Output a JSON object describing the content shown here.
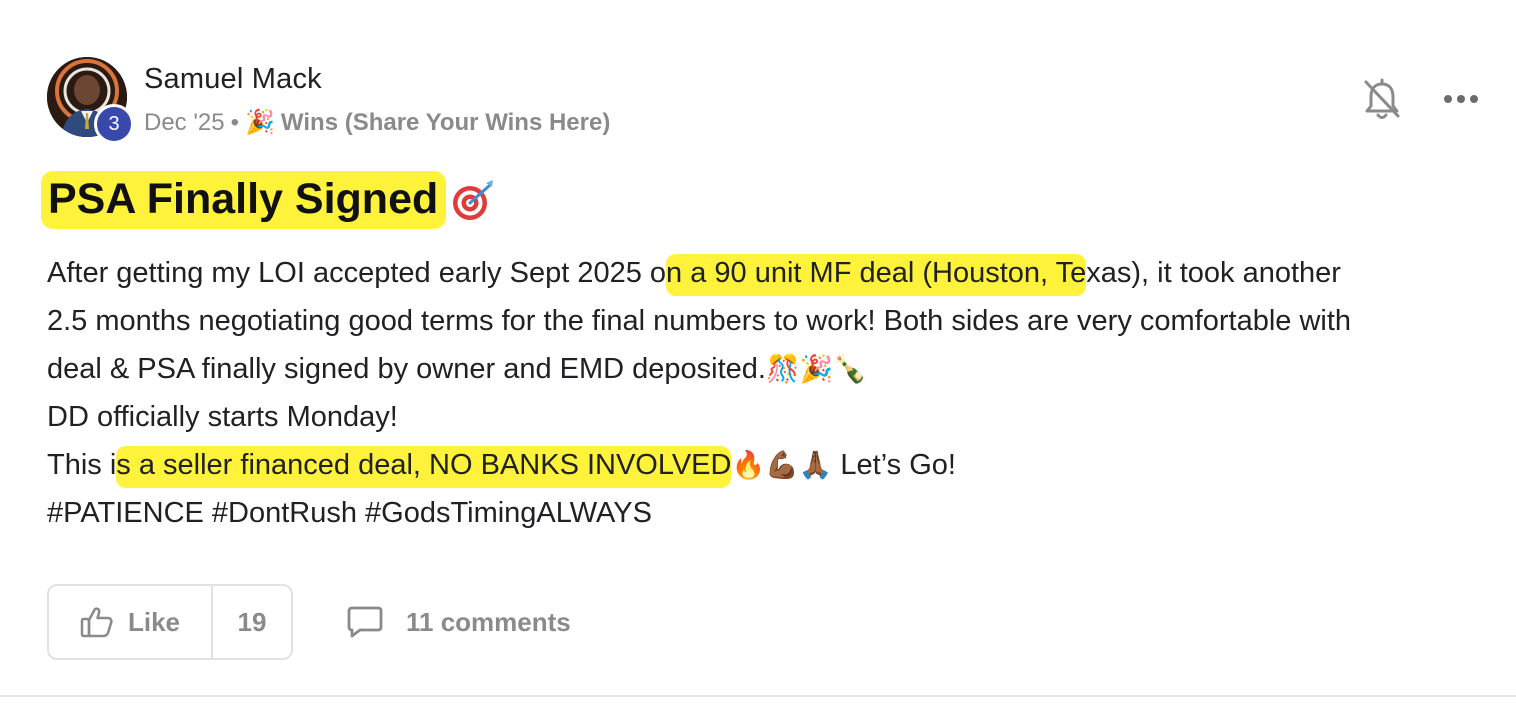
{
  "author": {
    "name": "Samuel Mack",
    "level": "3"
  },
  "meta": {
    "date": "Dec '25",
    "separator": "•",
    "category_icon": "party-popper-icon",
    "category": "Wins (Share Your Wins Here)"
  },
  "post": {
    "title": "PSA Finally Signed",
    "title_icon": "dart-target-icon",
    "body": {
      "l1_pre": "After getting my LOI accepted early Sept 2025 o",
      "l1_hl": "n a 90 unit MF deal (Houston, Te",
      "l1_post": "xas), it took another",
      "l2": "2.5 months negotiating good terms for the final numbers to work! Both sides are very comfortable with",
      "l3": "deal & PSA finally signed by owner and EMD deposited.",
      "l3_emoji": "🎊🎉🍾",
      "l4": "DD officially starts Monday!",
      "l5_pre": "This i",
      "l5_hl": "s a seller financed deal, NO BANKS INVOLVED",
      "l5_emoji": "🔥💪🏾🙏🏾",
      "l5_post": " Let’s Go!",
      "l6": "#PATIENCE #DontRush #GodsTimingALWAYS"
    }
  },
  "actions": {
    "like_label": "Like",
    "like_count": "19",
    "comments_label": "11 comments"
  },
  "colors": {
    "highlight": "#fff23a",
    "badge": "#3949ab",
    "muted": "#8a8a8a"
  }
}
